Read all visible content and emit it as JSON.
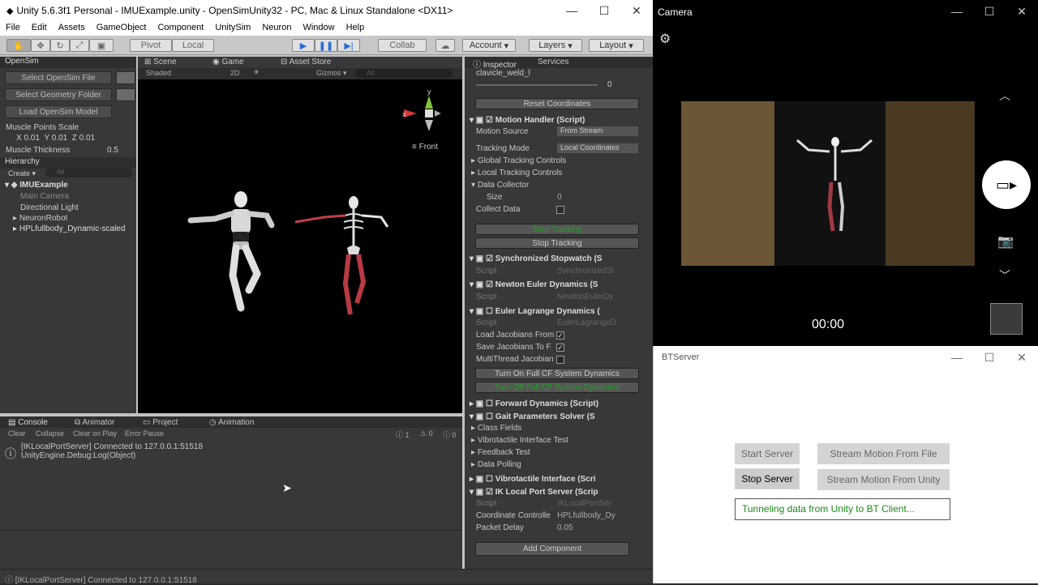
{
  "unity": {
    "title": "Unity 5.6.3f1 Personal - IMUExample.unity - OpenSimUnity32 - PC, Mac & Linux Standalone <DX11>",
    "menu": [
      "File",
      "Edit",
      "Assets",
      "GameObject",
      "Component",
      "UnitySim",
      "Neuron",
      "Window",
      "Help"
    ],
    "toolbar": {
      "pivot": "Pivot",
      "local": "Local",
      "collab": "Collab",
      "account": "Account",
      "layers": "Layers",
      "layout": "Layout"
    },
    "opensim": {
      "tab": "OpenSim",
      "select_model": "Select OpenSim File",
      "select_geometry": "Select Geometry Folder",
      "load_model": "Load OpenSim Model",
      "muscle_scale_label": "Muscle Points Scale",
      "scale_x": "0.01",
      "scale_y": "0.01",
      "scale_z": "0.01",
      "muscle_thickness_label": "Muscle Thickness",
      "muscle_thickness": "0.5"
    },
    "hierarchy": {
      "tab": "Hierarchy",
      "create": "Create",
      "search": "All",
      "scene": "IMUExample",
      "items": [
        "Main Camera",
        "Directional Light",
        "NeuronRobot",
        "HPLfullbody_Dynamic-scaled"
      ]
    },
    "scene": {
      "tabs": [
        "Scene",
        "Game",
        "Asset Store"
      ],
      "shading": "Shaded",
      "mode_2d": "2D",
      "gizmos": "Gizmos",
      "search": "All",
      "view": "Front"
    },
    "inspector": {
      "tabs": [
        "Inspector",
        "Services"
      ],
      "top_field": "clavicle_weld_l",
      "slider_value": "0",
      "reset": "Reset Coordinates",
      "motion_handler": "Motion Handler (Script)",
      "motion_source_label": "Motion Source",
      "motion_source": "From Stream",
      "tracking_mode_label": "Tracking Mode",
      "tracking_mode": "Local Coordinates",
      "global_tracking": "Global Tracking Controls",
      "local_tracking": "Local Tracking Controls",
      "data_collector": "Data Collector",
      "size_label": "Size",
      "size": "0",
      "collect_data": "Collect Data",
      "start_tracking": "Start Tracking",
      "stop_tracking": "Stop Tracking",
      "sync_stopwatch": "Synchronized Stopwatch (S",
      "script_label": "Script",
      "sync_script": "SynchronizedSt",
      "newton_euler": "Newton Euler Dynamics (S",
      "newton_script": "NewtonEulerDy",
      "euler_lagrange": "Euler Lagrange Dynamics (",
      "euler_script": "EulerLagrangeD",
      "load_jacobians": "Load Jacobians From",
      "save_jacobians": "Save Jacobians To F",
      "multithread": "MultiThread Jacobian",
      "turn_on_cf": "Turn On Full CF System Dynamics",
      "turn_off_cf": "Turn Off Full CF System Dynamics",
      "forward_dynamics": "Forward Dynamics (Script)",
      "gait_params": "Gait Parameters Solver (S",
      "class_fields": "Class Fields",
      "vibro_test": "Vibrotactile Interface Test",
      "feedback_test": "Feedback Test",
      "data_polling": "Data Polling",
      "vibro_interface": "Vibrotactile Interface (Scri",
      "ik_server": "IK Local Port Server (Scrip",
      "ik_script": "IKLocalPortSer",
      "coord_controller_label": "Coordinate Controlle",
      "coord_controller": "HPLfullbody_Dy",
      "packet_delay_label": "Packet Delay",
      "packet_delay": "0.05",
      "add_component": "Add Component"
    },
    "console": {
      "tabs": [
        "Console",
        "Animator",
        "Project",
        "Animation"
      ],
      "buttons": [
        "Clear",
        "Collapse",
        "Clear on Play",
        "Error Pause"
      ],
      "counts": [
        "1",
        "0",
        "0"
      ],
      "log_line1": "[IKLocalPortServer] Connected to 127.0.0.1:51518",
      "log_line2": "UnityEngine.Debug:Log(Object)"
    },
    "status": "[IKLocalPortServer] Connected to 127.0.0.1:51518"
  },
  "camera": {
    "title": "Camera",
    "timer": "00:00"
  },
  "btserver": {
    "title": "BTServer",
    "start_server": "Start Server",
    "stop_server": "Stop Server",
    "stream_file": "Stream Motion From File",
    "stream_unity": "Stream Motion From Unity",
    "status": "Tunneling data from Unity to BT Client..."
  }
}
